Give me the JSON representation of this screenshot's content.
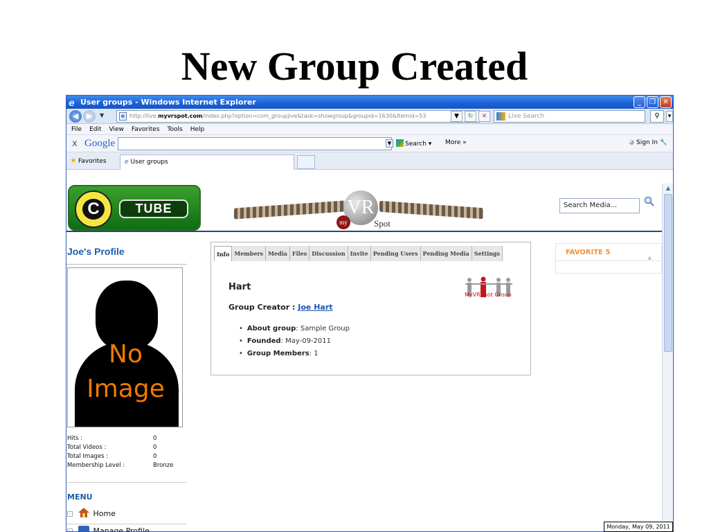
{
  "slide": {
    "title": "New Group Created"
  },
  "window": {
    "title": "User groups - Windows Internet Explorer",
    "address_prefix": "http://live.",
    "address_domain": "myvrspot.com",
    "address_rest": "/index.php?option=com_groupjive&task=showgroup&groupid=1630&Itemid=53",
    "live_search_placeholder": "Live Search"
  },
  "menubar": [
    "File",
    "Edit",
    "View",
    "Favorites",
    "Tools",
    "Help"
  ],
  "google": {
    "x": "x",
    "logo": "Google",
    "search": "Search",
    "more": "More »",
    "sign_in": "Sign In"
  },
  "tabs": {
    "favorites": "Favorites",
    "current_tab": "User groups"
  },
  "site": {
    "logo_letter": "C",
    "logo_word": "TUBE",
    "banner_vr": "VR",
    "banner_my": "my",
    "banner_spot": "Spot",
    "search_value": "Search Media..."
  },
  "profile": {
    "title": "Joe's Profile",
    "photo_line1": "No",
    "photo_line2": "Image",
    "stats": [
      {
        "label": "Hits :",
        "value": "0"
      },
      {
        "label": "Total Videos :",
        "value": "0"
      },
      {
        "label": "Total Images :",
        "value": "0"
      },
      {
        "label": "Membership Level :",
        "value": "Bronze"
      }
    ]
  },
  "menu": {
    "title": "MENU",
    "items": [
      "Home",
      "Manage Profile"
    ]
  },
  "group_tabs": [
    "Info",
    "Members",
    "Media",
    "Files",
    "Discussion",
    "Invite",
    "Pending Users",
    "Pending Media",
    "Settings"
  ],
  "group": {
    "name": "Hart",
    "creator_label": "Group Creator :",
    "creator_name": "Joe Hart",
    "logo_caption": "MyVRSpot Group",
    "details": [
      {
        "label": "About group",
        "value": "Sample Group"
      },
      {
        "label": "Founded",
        "value": "May-09-2011"
      },
      {
        "label": "Group Members",
        "value": "1"
      }
    ]
  },
  "favorites": {
    "title": "FAVORITE 5"
  },
  "clock": "Monday, May 09, 2011"
}
